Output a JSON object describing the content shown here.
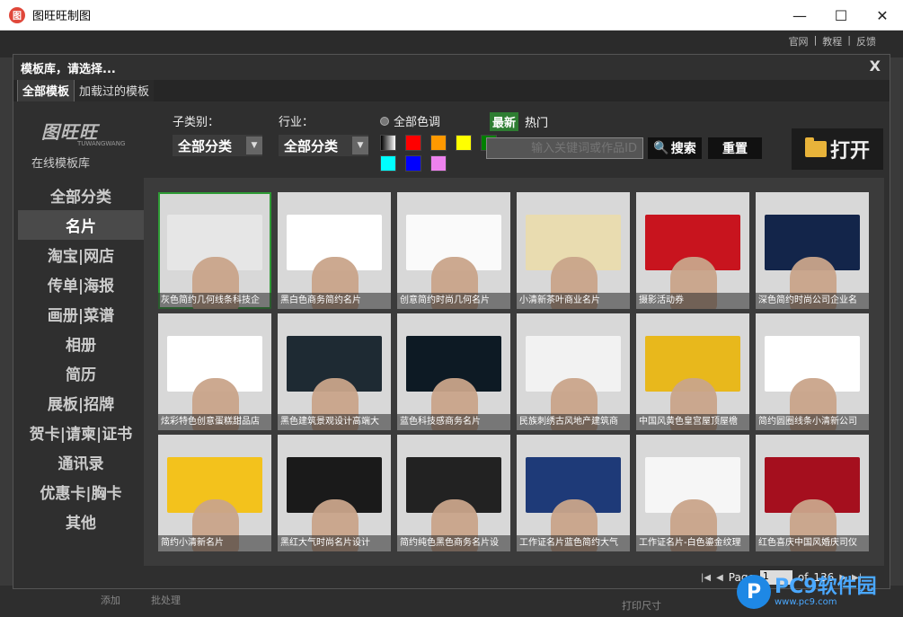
{
  "window": {
    "title": "图旺旺制图",
    "minimize": "—",
    "maximize": "☐",
    "close": "✕"
  },
  "background_app": {
    "links": [
      "官网",
      "|",
      "教程",
      "|",
      "反馈"
    ],
    "footer": {
      "add": "添加",
      "batch": "批处理",
      "print_size": "打印尺寸"
    }
  },
  "dialog": {
    "title": "模板库，请选择...",
    "close": "X",
    "tabs": [
      {
        "label": "全部模板",
        "active": true
      },
      {
        "label": "加载过的模板",
        "active": false
      }
    ],
    "logo": {
      "mark": "图旺旺",
      "sub": "TUWANGWANG",
      "caption": "在线模板库"
    },
    "categories": [
      {
        "label": "全部分类",
        "selected": false
      },
      {
        "label": "名片",
        "selected": true
      },
      {
        "label": "淘宝|网店",
        "selected": false
      },
      {
        "label": "传单|海报",
        "selected": false
      },
      {
        "label": "画册|菜谱",
        "selected": false
      },
      {
        "label": "相册",
        "selected": false
      },
      {
        "label": "简历",
        "selected": false
      },
      {
        "label": "展板|招牌",
        "selected": false
      },
      {
        "label": "贺卡|请柬|证书",
        "selected": false
      },
      {
        "label": "通讯录",
        "selected": false
      },
      {
        "label": "优惠卡|胸卡",
        "selected": false
      },
      {
        "label": "其他",
        "selected": false
      }
    ],
    "filters": {
      "subcategory_label": "子类别：",
      "subcategory_value": "全部分类",
      "industry_label": "行业：",
      "industry_value": "全部分类",
      "color_label": "全部色调",
      "colors": [
        "gradient-bw",
        "#ff0000",
        "#ff9900",
        "#ffff00",
        "#008000",
        "#00ffff",
        "#0000ff",
        "#ee82ee"
      ],
      "sort_newest": "最新",
      "sort_hot": "热门",
      "search_placeholder": "输入关键词或作品ID",
      "search_button": "搜索",
      "reset_button": "重置",
      "open_button": "打开"
    },
    "templates": [
      {
        "caption": "灰色简约几何线条科技企",
        "art": "#e6e6e6",
        "selected": true
      },
      {
        "caption": "黑白色商务简约名片",
        "art": "#ffffff",
        "selected": false
      },
      {
        "caption": "创意简约时尚几何名片",
        "art": "#fafafa",
        "selected": false
      },
      {
        "caption": "小清新茶叶商业名片",
        "art": "#e9dcb0",
        "selected": false
      },
      {
        "caption": "摄影活动券",
        "art": "#c8141e",
        "selected": false
      },
      {
        "caption": "深色简约时尚公司企业名",
        "art": "#13254a",
        "selected": false
      },
      {
        "caption": "炫彩特色创意蛋糕甜品店",
        "art": "#ffffff",
        "selected": false
      },
      {
        "caption": "黑色建筑景观设计高端大",
        "art": "#1e2a33",
        "selected": false
      },
      {
        "caption": "蓝色科技感商务名片",
        "art": "#0d1a24",
        "selected": false
      },
      {
        "caption": "民族刺绣古风地产建筑商",
        "art": "#f2f2f2",
        "selected": false
      },
      {
        "caption": "中国风黄色皇宫屋顶屋檐",
        "art": "#e8b81c",
        "selected": false
      },
      {
        "caption": "简约圆圈线条小清新公司",
        "art": "#ffffff",
        "selected": false
      },
      {
        "caption": "简约小清新名片",
        "art": "#f3c21c",
        "selected": false
      },
      {
        "caption": "黑红大气时尚名片设计",
        "art": "#1a1a1a",
        "selected": false
      },
      {
        "caption": "简约纯色黑色商务名片设",
        "art": "#222222",
        "selected": false
      },
      {
        "caption": "工作证名片蓝色简约大气",
        "art": "#1e3a78",
        "selected": false
      },
      {
        "caption": "工作证名片-白色鎏金纹理",
        "art": "#f6f6f6",
        "selected": false
      },
      {
        "caption": "红色喜庆中国风婚庆司仪",
        "art": "#a50f1e",
        "selected": false
      }
    ],
    "pagination": {
      "first": "|◀",
      "prev": "◀",
      "page_label": "Page",
      "page_value": "1",
      "of_label": "of",
      "total": "136",
      "next": "▶",
      "last": "▶|"
    }
  },
  "watermark": {
    "logo": "P",
    "text": "PC9软件园",
    "url": "www.pc9.com"
  }
}
